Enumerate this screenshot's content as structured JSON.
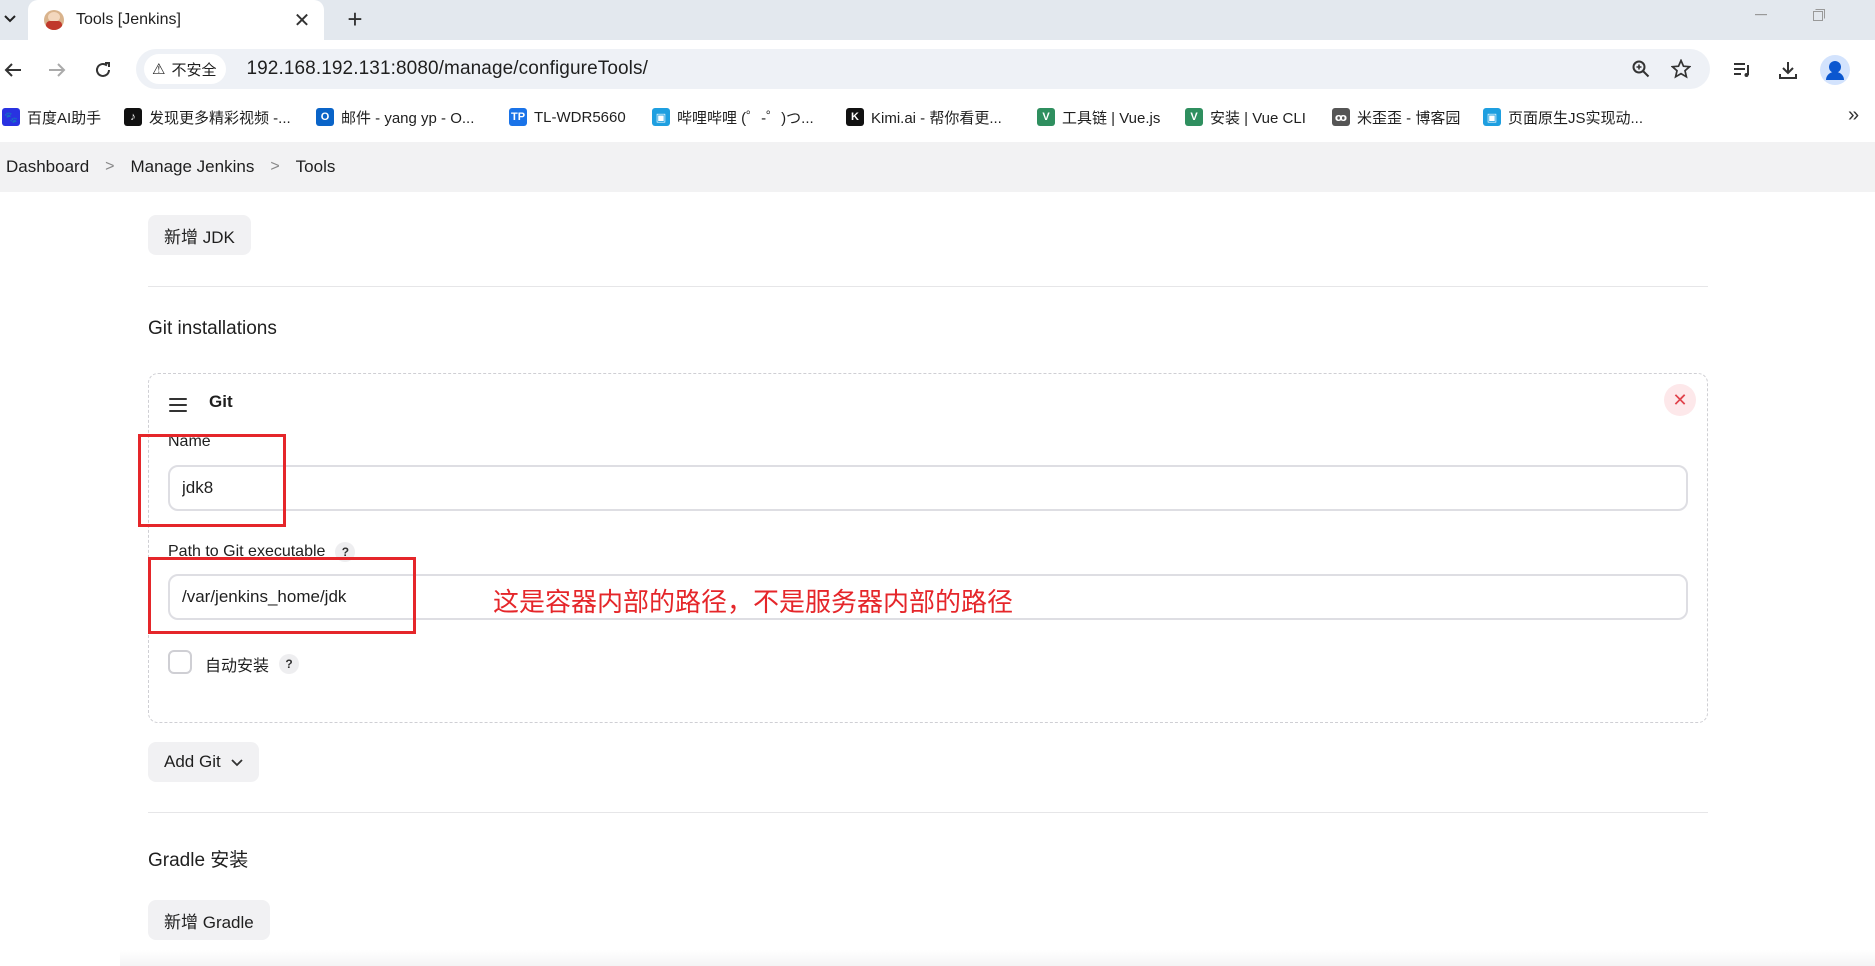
{
  "browser": {
    "tab_title": "Tools [Jenkins]",
    "tab_close": "✕",
    "new_tab": "+",
    "security_label": "不安全",
    "url": "192.168.192.131:8080/manage/configureTools/",
    "bookmarks": [
      {
        "label": "百度AI助手",
        "icon": "baidu-icon",
        "color": "#2932e1",
        "glyph": "🐾"
      },
      {
        "label": "发现更多精彩视频 -...",
        "icon": "tiktok-icon",
        "color": "#111111",
        "glyph": "♪"
      },
      {
        "label": "邮件 - yang yp - O...",
        "icon": "outlook-icon",
        "color": "#0a64c8",
        "glyph": "O"
      },
      {
        "label": "TL-WDR5660",
        "icon": "tplink-icon",
        "color": "#1a73e8",
        "glyph": "TP"
      },
      {
        "label": "哔哩哔哩 (゜-゜)つ...",
        "icon": "bilibili-icon",
        "color": "#1e9fe0",
        "glyph": "▣"
      },
      {
        "label": "Kimi.ai - 帮你看更...",
        "icon": "kimi-icon",
        "color": "#111111",
        "glyph": "K"
      },
      {
        "label": "工具链 | Vue.js",
        "icon": "vue-icon",
        "color": "#2f8f5f",
        "glyph": "V"
      },
      {
        "label": "安装 | Vue CLI",
        "icon": "vue-icon",
        "color": "#2f8f5f",
        "glyph": "V"
      },
      {
        "label": "米歪歪 - 博客园",
        "icon": "cnblogs-icon",
        "color": "#555555",
        "glyph": "ꝏ"
      },
      {
        "label": "页面原生JS实现动...",
        "icon": "bilibili-icon",
        "color": "#1e9fe0",
        "glyph": "▣"
      }
    ],
    "more_bookmarks": "»"
  },
  "breadcrumb": {
    "items": [
      "Dashboard",
      "Manage Jenkins",
      "Tools"
    ],
    "separator": ">"
  },
  "page": {
    "add_jdk_button": "新增 JDK",
    "git_section_title": "Git installations",
    "git_box": {
      "title": "Git",
      "delete": "✕",
      "name_label": "Name",
      "name_value": "jdk8",
      "path_label": "Path to Git executable",
      "path_value": "/var/jenkins_home/jdk",
      "auto_install_label": "自动安装",
      "help": "?"
    },
    "add_git_button": "Add Git",
    "gradle_section_title": "Gradle 安装",
    "add_gradle_button": "新增 Gradle"
  },
  "annotation": {
    "note": "这是容器内部的路径，不是服务器内部的路径",
    "color": "#e5262a"
  }
}
